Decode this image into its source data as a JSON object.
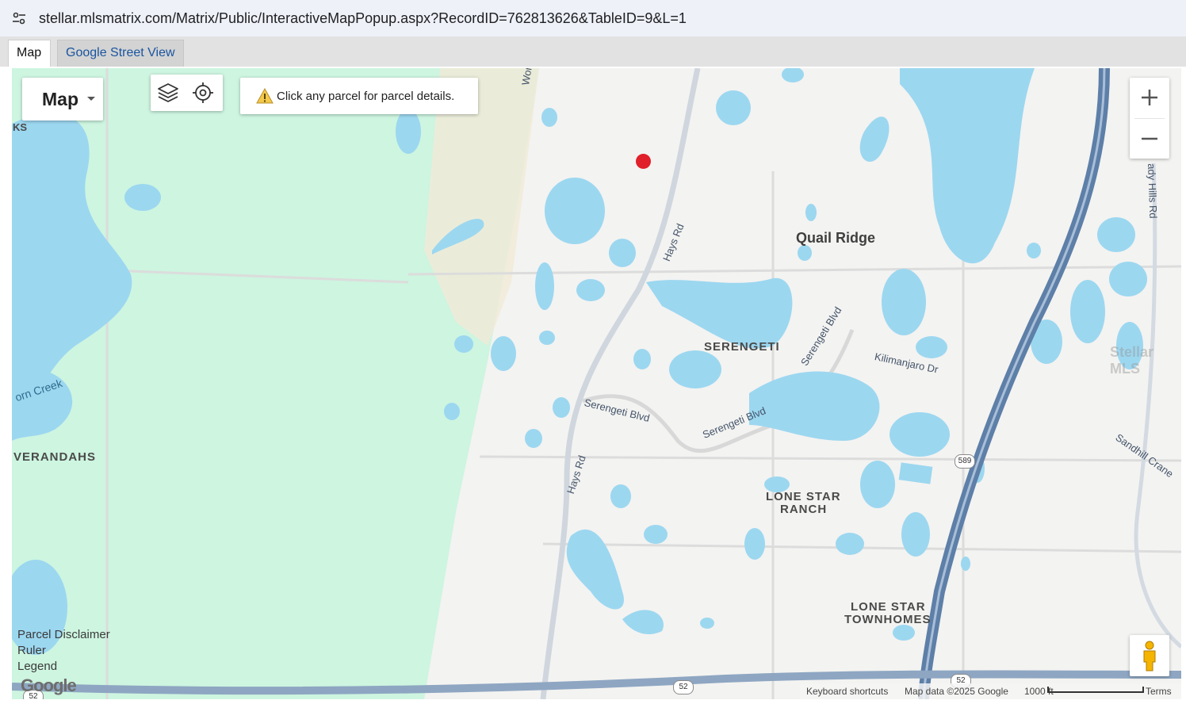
{
  "browser": {
    "url": "stellar.mlsmatrix.com/Matrix/Public/InteractiveMapPopup.aspx?RecordID=762813626&TableID=9&L=1",
    "site_settings_icon": "tune-icon"
  },
  "tabs": [
    {
      "label": "Map",
      "active": true
    },
    {
      "label": "Google Street View",
      "active": false
    }
  ],
  "map": {
    "type_selector": {
      "label": "Map",
      "icon": "caret-down-icon"
    },
    "tools": [
      {
        "icon": "layers-icon"
      },
      {
        "icon": "my-location-icon"
      }
    ],
    "notice": {
      "icon": "warning-icon",
      "text": "Click any parcel for parcel details."
    },
    "zoom": {
      "in_label": "+",
      "out_label": "−"
    },
    "places": {
      "quail_ridge": "Quail Ridge",
      "serengeti": "SERENGETI",
      "lone_star_ranch_1": "LONE STAR",
      "lone_star_ranch_2": "RANCH",
      "lone_star_townhomes_1": "LONE STAR",
      "lone_star_townhomes_2": "TOWNHOMES",
      "verandahs": "VERANDAHS",
      "ks": "KS",
      "creek": "orn Creek"
    },
    "roads": {
      "hays_rd_north": "Hays Rd",
      "hays_rd_south": "Hays Rd",
      "serengeti_blvd_1": "Serengeti Blvd",
      "serengeti_blvd_2": "Serengeti Blvd",
      "serengeti_blvd_3": "Serengeti Blvd",
      "kilimanjaro_dr": "Kilimanjaro Dr",
      "shady_hills_rd": "ady Hills Rd",
      "sandhill_crane": "Sandhill Crane",
      "wor": "Wor"
    },
    "shields": {
      "route_589": "589",
      "route_52_a": "52",
      "route_52_b": "52",
      "route_52_c": "52"
    },
    "links": {
      "parcel_disclaimer": "Parcel Disclaimer",
      "ruler": "Ruler",
      "legend": "Legend"
    },
    "google_logo": "Google",
    "watermark": "Stellar MLS",
    "footer": {
      "keyboard_shortcuts": "Keyboard shortcuts",
      "map_data": "Map data ©2025 Google",
      "scale": "1000 ft",
      "terms": "Terms"
    },
    "colors": {
      "water": "#9cd7f0",
      "park": "#cdf5e0",
      "land": "#f3f3f1",
      "highway": "#5d7fa8",
      "marker": "#e0202a"
    }
  }
}
